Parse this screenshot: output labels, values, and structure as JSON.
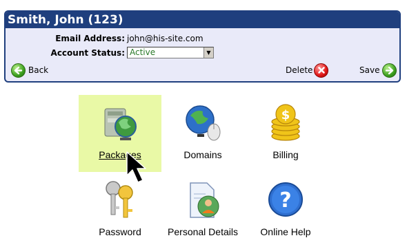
{
  "header": {
    "title": "Smith, John (123)"
  },
  "fields": {
    "email_label": "Email Address:",
    "email_value": "john@his-site.com",
    "status_label": "Account Status:",
    "status_value": "Active"
  },
  "actions": {
    "back": "Back",
    "delete": "Delete",
    "save": "Save"
  },
  "tiles": [
    {
      "label": "Packages",
      "icon": "packages-icon",
      "hovered": true
    },
    {
      "label": "Domains",
      "icon": "globe-mouse-icon"
    },
    {
      "label": "Billing",
      "icon": "coins-icon"
    },
    {
      "label": "Password",
      "icon": "keys-icon"
    },
    {
      "label": "Personal Details",
      "icon": "person-document-icon"
    },
    {
      "label": "Online Help",
      "icon": "help-icon"
    }
  ],
  "colors": {
    "panel_border": "#1f3f7e",
    "panel_bg": "#e9eaf9",
    "hover_bg": "#e9f9a6",
    "status_text": "#2a7a2a"
  }
}
